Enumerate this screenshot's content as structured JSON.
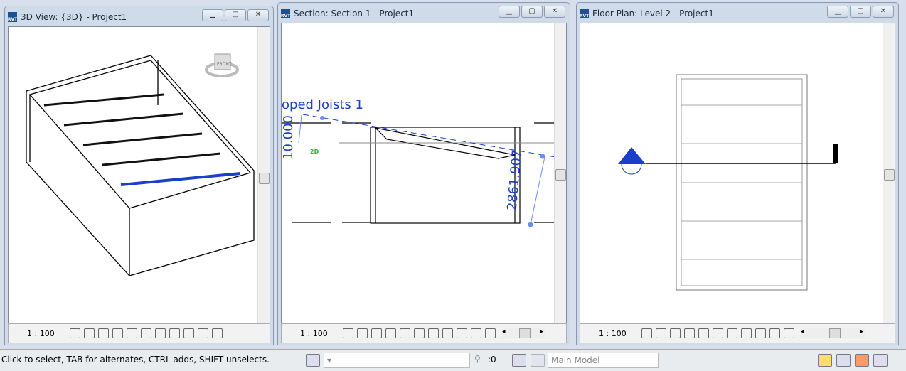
{
  "windows": [
    {
      "title": "3D View: {3D} - Project1",
      "scale": "1 : 100",
      "viewcube_label": "FRONT"
    },
    {
      "title": "Section: Section 1 - Project1",
      "scale": "1 : 100",
      "tag": "oped Joists 1",
      "dim_left": "10.000",
      "dim_right": "2861.907",
      "badge_2d": "2D"
    },
    {
      "title": "Floor Plan: Level 2 - Project1",
      "scale": "1 : 100"
    }
  ],
  "controls": {
    "minimize": "▁",
    "restore": "▢",
    "close": "✕"
  },
  "status": {
    "message": "Click to select, TAB for alternates, CTRL adds, SHIFT unselects.",
    "selection_count": ":0",
    "model": "Main Model"
  },
  "icons": [
    "rvt-icon",
    "visual-style-icon",
    "crop-icon",
    "sun-icon",
    "shadows-icon",
    "temporary-hide-icon",
    "reveal-icon",
    "lock-3d-icon",
    "worksharing-icon",
    "select-links-icon",
    "select-pinned-icon",
    "filter-icon"
  ],
  "colors": {
    "selection": "#1a3fc8",
    "frame": "#cfdbe9"
  }
}
